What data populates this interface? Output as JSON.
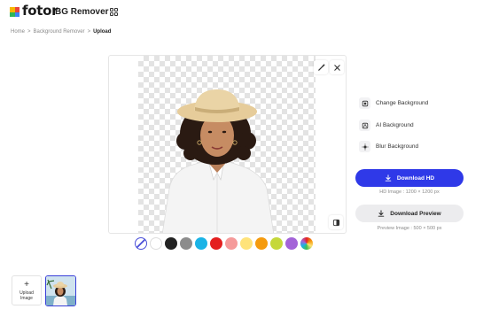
{
  "header": {
    "brand": "fotor",
    "product": "BG Remover",
    "logo_colors": [
      "#f7b500",
      "#e8453c",
      "#2fb55a",
      "#3c82f6"
    ],
    "apps_icon": "grid-icon"
  },
  "breadcrumb": {
    "items": [
      "Home",
      "Background Remover",
      "Upload"
    ],
    "separator": ">"
  },
  "canvas": {
    "tools": [
      "brush-icon",
      "magic-erase-icon",
      "compare-icon"
    ]
  },
  "options": [
    {
      "label": "Change Background",
      "icon": "change-background-icon"
    },
    {
      "label": "AI Background",
      "icon": "ai-background-icon"
    },
    {
      "label": "Blur Background",
      "icon": "blur-background-icon"
    }
  ],
  "download_hd": {
    "label": "Download HD",
    "note": "HD Image : 1200 × 1200 px",
    "color": "#2f39e8"
  },
  "download_preview": {
    "label": "Download Preview",
    "note": "Preview Image : 500 × 500 px"
  },
  "swatches": [
    "transparent",
    "#ffffff",
    "#222222",
    "#8c8c8c",
    "#1ab3e6",
    "#e41f1f",
    "#f59a9a",
    "#ffe37a",
    "#f59b0e",
    "#c5d83a",
    "#a363d8",
    "rainbow"
  ],
  "upload": {
    "label_line1": "Upload",
    "label_line2": "Image"
  }
}
